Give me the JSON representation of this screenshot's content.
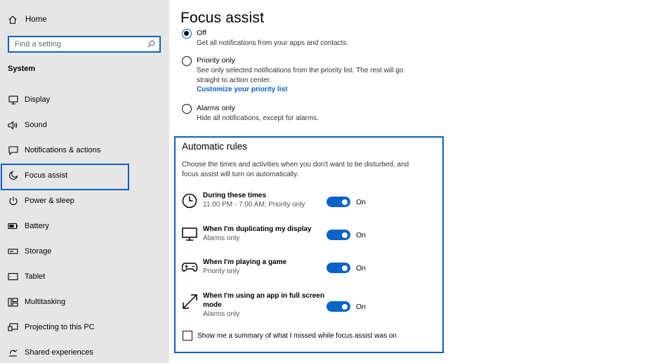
{
  "sidebar": {
    "home_label": "Home",
    "search_placeholder": "Find a setting",
    "section_title": "System",
    "items": [
      {
        "label": "Display"
      },
      {
        "label": "Sound"
      },
      {
        "label": "Notifications & actions"
      },
      {
        "label": "Focus assist",
        "selected": true
      },
      {
        "label": "Power & sleep"
      },
      {
        "label": "Battery"
      },
      {
        "label": "Storage"
      },
      {
        "label": "Tablet"
      },
      {
        "label": "Multitasking"
      },
      {
        "label": "Projecting to this PC"
      },
      {
        "label": "Shared experiences"
      }
    ]
  },
  "main": {
    "title": "Focus assist",
    "options": [
      {
        "label": "Off",
        "desc": "Get all notifications from your apps and contacts.",
        "checked": true
      },
      {
        "label": "Priority only",
        "desc": "See only selected notifications from the priority list. The rest will go straight to action center.",
        "link": "Customize your priority list",
        "checked": false
      },
      {
        "label": "Alarms only",
        "desc": "Hide all notifications, except for alarms.",
        "checked": false
      }
    ],
    "rules": {
      "title": "Automatic rules",
      "desc": "Choose the times and activities when you don't want to be disturbed, and focus assist will turn on automatically.",
      "items": [
        {
          "name": "During these times",
          "sub": "11:00 PM - 7:00 AM; Priority only",
          "toggle": "On",
          "icon": "clock-icon"
        },
        {
          "name": "When I'm duplicating my display",
          "sub": "Alarms only",
          "toggle": "On",
          "icon": "monitor-icon"
        },
        {
          "name": "When I'm playing a game",
          "sub": "Priority only",
          "toggle": "On",
          "icon": "gamepad-icon"
        },
        {
          "name": "When I'm using an app in full screen mode",
          "sub": "Alarms only",
          "toggle": "On",
          "icon": "fullscreen-icon"
        }
      ],
      "summary_checkbox": "Show me a summary of what I missed while focus assist was on"
    }
  }
}
